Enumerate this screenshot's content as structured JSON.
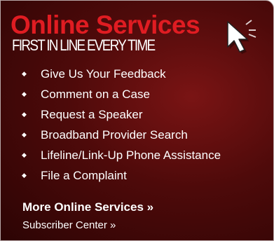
{
  "header": {
    "title": "Online Services",
    "tagline": "FIRST IN LINE EVERY TIME",
    "cursor_icon": "mouse-pointer-icon"
  },
  "services": {
    "bullet_icon": "diamond-bullet-icon",
    "items": [
      {
        "label": "Give Us Your Feedback"
      },
      {
        "label": "Comment on a Case"
      },
      {
        "label": "Request a Speaker"
      },
      {
        "label": "Broadband Provider Search"
      },
      {
        "label": "Lifeline/Link-Up Phone Assistance"
      },
      {
        "label": "File a Complaint"
      }
    ]
  },
  "footer": {
    "more_label": "More Online Services »",
    "subscriber_label": "Subscriber Center »"
  },
  "colors": {
    "title_red": "#e01c22",
    "panel_dark_red": "#4e0a0a",
    "text": "#ffffff"
  }
}
